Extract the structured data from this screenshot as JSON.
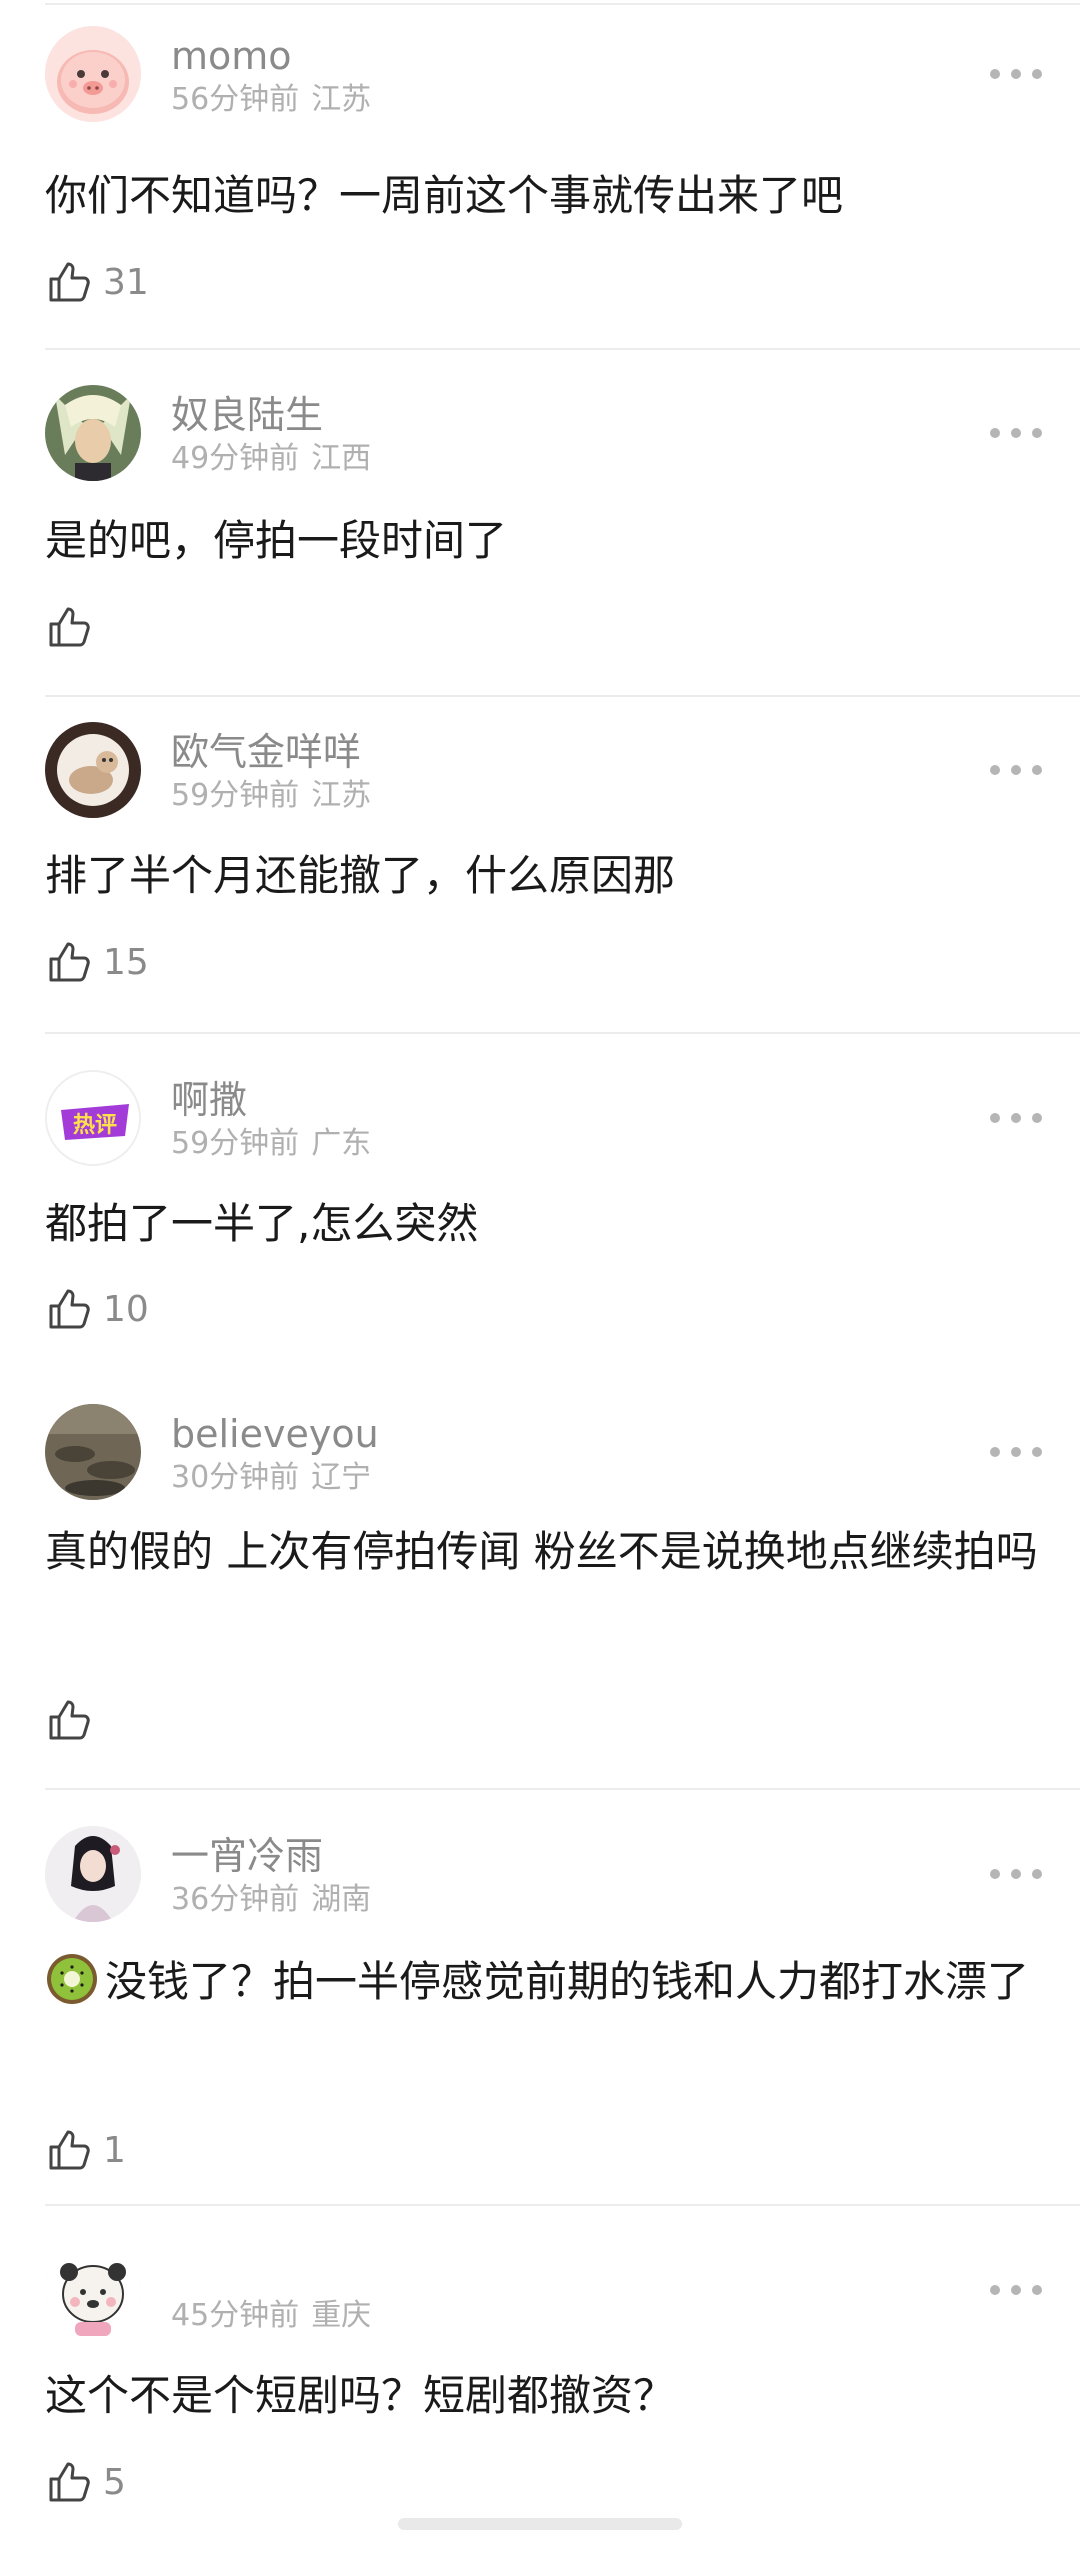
{
  "comments": [
    {
      "username": "momo",
      "time": "56分钟前",
      "location": "江苏",
      "text": "你们不知道吗？一周前这个事就传出来了吧",
      "likes": "31",
      "avatar": "pink-pig-avatar"
    },
    {
      "username": "奴良陆生",
      "time": "49分钟前",
      "location": "江西",
      "text": "是的吧，停拍一段时间了",
      "likes": "",
      "avatar": "anime-character-avatar"
    },
    {
      "username": "欧气金咩咩",
      "time": "59分钟前",
      "location": "江苏",
      "text": "排了半个月还能撤了，什么原因那",
      "likes": "15",
      "avatar": "cat-photo-avatar"
    },
    {
      "username": "啊撒",
      "time": "59分钟前",
      "location": "广东",
      "text": "都拍了一半了,怎么突然",
      "likes": "10",
      "avatar": "hot-review-badge-avatar",
      "avatar_text": "热评"
    },
    {
      "username": "believeyou",
      "time": "30分钟前",
      "location": "辽宁",
      "text": "真的假的 上次有停拍传闻 粉丝不是说换地点继续拍吗",
      "likes": "",
      "avatar": "landscape-photo-avatar"
    },
    {
      "username": "一宵冷雨",
      "time": "36分钟前",
      "location": "湖南",
      "emoji": "kiwi-emoji",
      "text": "没钱了？拍一半停感觉前期的钱和人力都打水漂了",
      "likes": "1",
      "avatar": "girl-illustration-avatar"
    },
    {
      "username": "",
      "time": "45分钟前",
      "location": "重庆",
      "text": "这个不是个短剧吗？短剧都撤资？",
      "likes": "5",
      "avatar": "panda-sticker-avatar"
    }
  ],
  "colors": {
    "text": "#1a1a1a",
    "username": "#8a8a8a",
    "meta": "#b0b0b0",
    "divider": "#ececec"
  }
}
